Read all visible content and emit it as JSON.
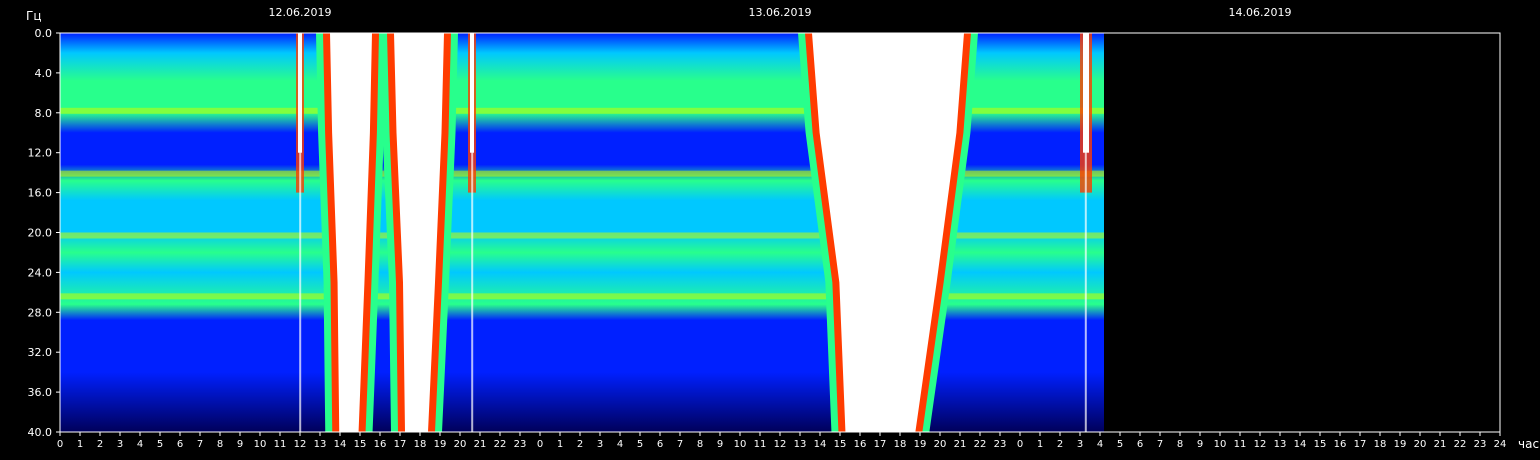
{
  "chart_data": {
    "type": "heatmap",
    "title": "",
    "ylabel": "Гц",
    "xlabel": "час",
    "ylim": [
      0,
      40
    ],
    "y_inverted": true,
    "y_ticks": [
      "0.0",
      "4.0",
      "8.0",
      "12.0",
      "16.0",
      "20.0",
      "24.0",
      "28.0",
      "32.0",
      "36.0",
      "40.0"
    ],
    "y_values": [
      0,
      4,
      8,
      12,
      16,
      20,
      24,
      28,
      32,
      36,
      40
    ],
    "x_ticks": [
      "0",
      "1",
      "2",
      "3",
      "4",
      "5",
      "6",
      "7",
      "8",
      "9",
      "10",
      "11",
      "12",
      "13",
      "14",
      "15",
      "16",
      "17",
      "18",
      "19",
      "20",
      "21",
      "22",
      "23",
      "0",
      "1",
      "2",
      "3",
      "4",
      "5",
      "6",
      "7",
      "8",
      "9",
      "10",
      "11",
      "12",
      "13",
      "14",
      "15",
      "16",
      "17",
      "18",
      "19",
      "20",
      "21",
      "22",
      "23",
      "0",
      "1",
      "2",
      "3",
      "4",
      "5",
      "6",
      "7",
      "8",
      "9",
      "10",
      "11",
      "12",
      "13",
      "14",
      "15",
      "16",
      "17",
      "18",
      "19",
      "20",
      "21",
      "22",
      "23",
      "24"
    ],
    "dates": [
      "12.06.2019",
      "13.06.2019",
      "14.06.2019"
    ],
    "xlim_hours": [
      0,
      72
    ],
    "data_end_hour": 52.2,
    "color_scale": [
      "#00005a",
      "#0020ff",
      "#00c8ff",
      "#28ff8c",
      "#c8ff00",
      "#ff3c00",
      "#ffffff"
    ],
    "background_color": "#000000",
    "features": {
      "resonance_bands_hz": [
        7.8,
        14.1,
        20.3,
        26.4
      ],
      "bright_events_hours": [
        {
          "start": 11.8,
          "end": 12.2
        },
        {
          "start": 13.5,
          "end": 15.6
        },
        {
          "start": 16.7,
          "end": 19.2
        },
        {
          "start": 20.4,
          "end": 20.8
        },
        {
          "start": 37.6,
          "end": 45.2
        },
        {
          "start": 51.0,
          "end": 51.6
        }
      ]
    }
  }
}
